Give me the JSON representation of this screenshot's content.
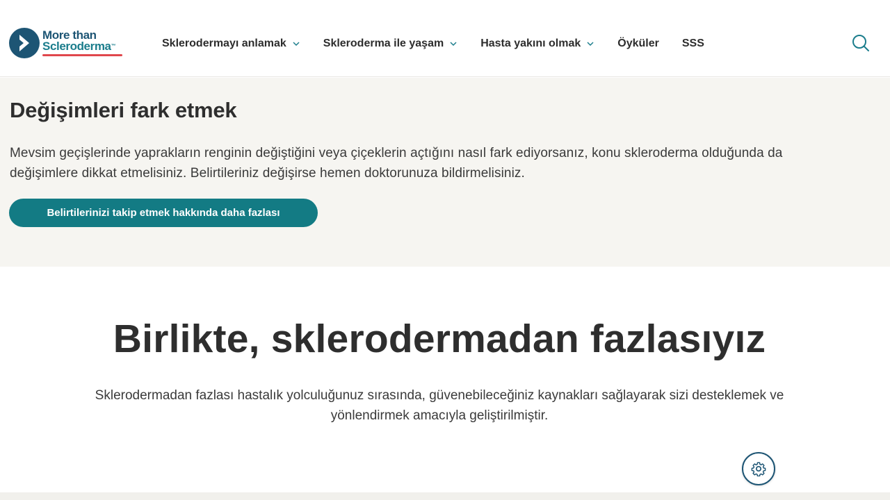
{
  "header": {
    "logo": {
      "line1": "More than",
      "line2": "Scleroderma",
      "trademark": "™",
      "icon": "chevron-right-icon"
    },
    "nav": [
      {
        "label": "Sklerodermayı anlamak",
        "dropdown": true
      },
      {
        "label": "Skleroderma ile yaşam",
        "dropdown": true
      },
      {
        "label": "Hasta yakını olmak",
        "dropdown": true
      },
      {
        "label": "Öyküler",
        "dropdown": false
      },
      {
        "label": "SSS",
        "dropdown": false
      }
    ],
    "search_icon": "search-icon"
  },
  "beige_section": {
    "title": "Değişimleri fark etmek",
    "paragraph": "Mevsim geçişlerinde yaprakların renginin değiştiğini veya çiçeklerin açtığını nasıl fark ediyorsanız, konu skleroderma olduğunda da değişimlere dikkat etmelisiniz. Belirtileriniz değişirse hemen doktorunuza bildirmelisiniz.",
    "button_label": "Belirtilerinizi takip etmek hakkında daha fazlası"
  },
  "main_section": {
    "title": "Birlikte, sklerodermadan fazlasıyız",
    "paragraph": "Sklerodermadan fazlası hastalık yolculuğunuz sırasında, güvenebileceğiniz kaynakları sağlayarak sizi desteklemek ve yönlendirmek amacıyla geliştirilmiştir."
  },
  "settings_icon": "gear-icon",
  "colors": {
    "brand_navy": "#1d5574",
    "brand_teal": "#137b84",
    "brand_red": "#e0474c",
    "beige_bg": "#f6f5f1"
  }
}
